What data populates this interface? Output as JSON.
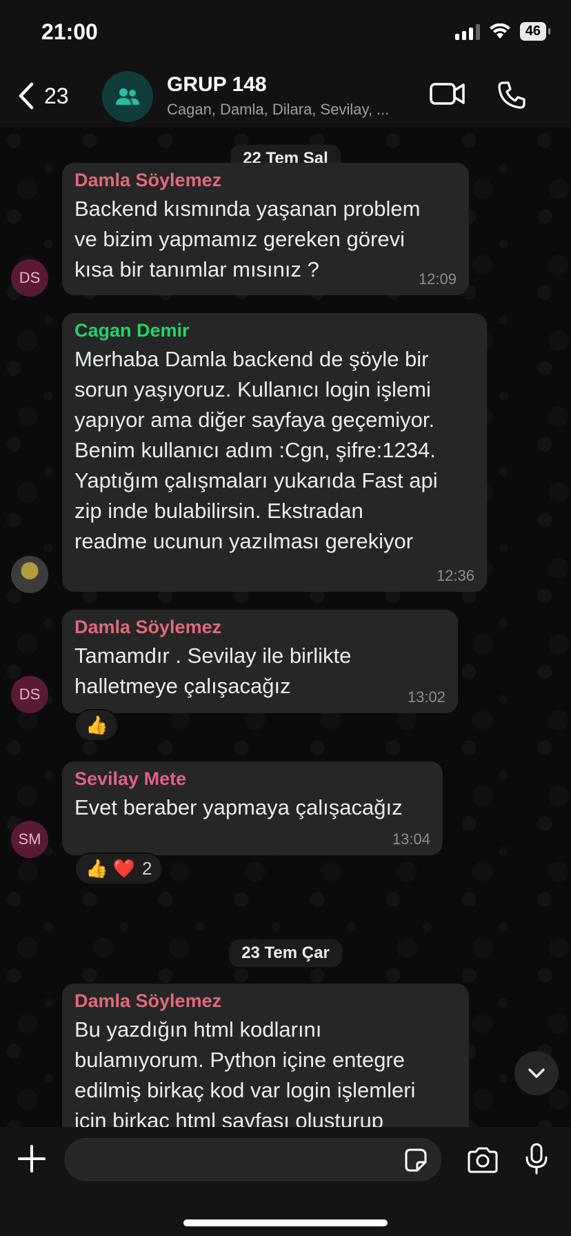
{
  "status_bar": {
    "time": "21:00",
    "battery": "46"
  },
  "header": {
    "back_count": "23",
    "title": "GRUP 148",
    "subtitle": "Cagan, Damla, Dilara, Sevilay, ..."
  },
  "colors": {
    "damla": "#e0697d",
    "cagan": "#25d366",
    "sevilay": "#e0608a"
  },
  "dates": [
    "22 Tem Sal",
    "23 Tem Çar"
  ],
  "messages": [
    {
      "sender": "Damla Söylemez",
      "text": "Backend kısmında yaşanan problem\nve bizim yapmamız gereken görevi\nkısa bir tanımlar mısınız ?",
      "time": "12:09",
      "avatar": "DS"
    },
    {
      "sender": "Cagan Demir",
      "text": "Merhaba Damla backend de şöyle bir\nsorun yaşıyoruz. Kullanıcı login işlemi\nyapıyor ama diğer sayfaya geçemiyor.\nBenim kullanıcı adım :Cgn, şifre:1234.\nYaptığım çalışmaları yukarıda Fast api\nzip inde bulabilirsin. Ekstradan\nreadme ucunun yazılması gerekiyor",
      "time": "12:36"
    },
    {
      "sender": "Damla Söylemez",
      "text": "Tamamdır . Sevilay ile birlikte\nhalletmeye çalışacağız",
      "time": "13:02",
      "avatar": "DS",
      "reaction": "👍"
    },
    {
      "sender": "Sevilay Mete",
      "text": "Evet beraber yapmaya çalışacağız",
      "time": "13:04",
      "avatar": "SM",
      "reaction": "👍 ❤️",
      "reaction_count": "2"
    },
    {
      "sender": "Damla Söylemez",
      "text": "Bu yazdığın html kodlarını\nbulamıyorum. Python içine entegre\nedilmiş birkaç kod var login işlemleri\niçin birkaç html sayfası oluşturup"
    }
  ],
  "composer": {
    "placeholder": ""
  },
  "icons": {
    "back": "chevron-left-icon",
    "group": "group-icon",
    "video": "video-call-icon",
    "phone": "phone-icon",
    "plus": "plus-icon",
    "sticker": "sticker-icon",
    "camera": "camera-icon",
    "mic": "microphone-icon",
    "scroll": "chevron-down-icon"
  }
}
